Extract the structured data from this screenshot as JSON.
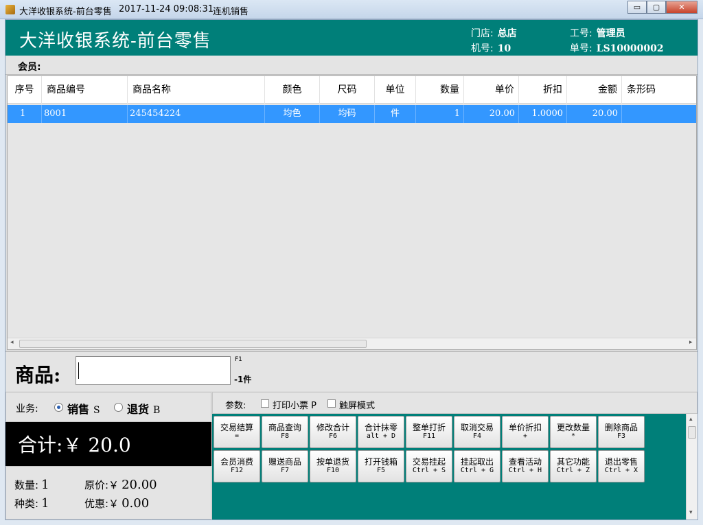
{
  "window": {
    "title": "大洋收银系统-前台零售",
    "datetime": "2017-11-24 09:08:31",
    "mode": "连机销售",
    "minimize": "▭",
    "maximize": "▢",
    "close": "✕"
  },
  "header": {
    "app_title": "大洋收银系统-前台零售",
    "store_label": "门店:",
    "store_value": "总店",
    "machine_label": "机号:",
    "machine_value": "10",
    "staff_label": "工号:",
    "staff_value": "管理员",
    "order_label": "单号:",
    "order_value": "LS10000002"
  },
  "member": {
    "label": "会员:"
  },
  "grid": {
    "columns": [
      "序号",
      "商品编号",
      "商品名称",
      "颜色",
      "尺码",
      "单位",
      "数量",
      "单价",
      "折扣",
      "金额",
      "条形码"
    ],
    "rows": [
      [
        "1",
        "8001",
        "245454224",
        "均色",
        "均码",
        "件",
        "1",
        "20.00",
        "1.0000",
        "20.00",
        ""
      ]
    ]
  },
  "product": {
    "label": "商品:",
    "input_value": "",
    "hotkey": "F1",
    "qty_hint": "-1件"
  },
  "business": {
    "label": "业务:",
    "sale_label": "销售",
    "sale_key": "S",
    "return_label": "退货",
    "return_key": "B",
    "selected": "sale"
  },
  "total": {
    "text": "合计:￥ 20.0"
  },
  "stats": {
    "qty_label": "数量:",
    "qty_value": "1",
    "orig_label": "原价:￥",
    "orig_value": "20.00",
    "kinds_label": "种类:",
    "kinds_value": "1",
    "discount_label": "优惠:￥",
    "discount_value": "0.00"
  },
  "params": {
    "label": "参数:",
    "print_receipt": "打印小票 P",
    "touch_mode": "触屏模式"
  },
  "buttons": [
    {
      "label": "交易结算",
      "key": "="
    },
    {
      "label": "商品查询",
      "key": "F8"
    },
    {
      "label": "修改合计",
      "key": "F6"
    },
    {
      "label": "合计抹零",
      "key": "alt + D"
    },
    {
      "label": "整单打折",
      "key": "F11"
    },
    {
      "label": "取消交易",
      "key": "F4"
    },
    {
      "label": "单价折扣",
      "key": "+"
    },
    {
      "label": "更改数量",
      "key": "*"
    },
    {
      "label": "删除商品",
      "key": "F3"
    },
    {
      "label": "会员消费",
      "key": "F12"
    },
    {
      "label": "赠送商品",
      "key": "F7"
    },
    {
      "label": "按单退货",
      "key": "F10"
    },
    {
      "label": "打开钱箱",
      "key": "F5"
    },
    {
      "label": "交易挂起",
      "key": "Ctrl + S"
    },
    {
      "label": "挂起取出",
      "key": "Ctrl + G"
    },
    {
      "label": "查看活动",
      "key": "Ctrl + H"
    },
    {
      "label": "其它功能",
      "key": "Ctrl + Z"
    },
    {
      "label": "退出零售",
      "key": "Ctrl + X"
    }
  ],
  "colors": {
    "header_teal": "#007f79",
    "selection_blue": "#3397ff",
    "total_bg": "#000000"
  }
}
